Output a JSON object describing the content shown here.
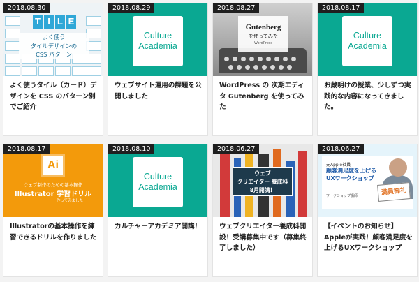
{
  "cards": [
    {
      "date": "2018.08.30",
      "title": "よく使うタイル（カード）デザインを CSS のパターン別でご紹介",
      "thumb_type": "tile",
      "thumb_text": {
        "word": [
          "T",
          "I",
          "L",
          "E"
        ],
        "line1": "よく使う",
        "line2": "タイルデザインの",
        "line3": "CSS パターン"
      }
    },
    {
      "date": "2018.08.29",
      "title": "ウェブサイト運用の課題を公開しました",
      "thumb_type": "culture",
      "thumb_text": {
        "line1": "Culture",
        "line2": "Academia"
      }
    },
    {
      "date": "2018.08.27",
      "title": "WordPress の 次期エディタ Gutenberg を使ってみた",
      "thumb_type": "gutenberg",
      "thumb_text": {
        "line1": "Gutenberg",
        "line2": "を使ってみた",
        "line3": "WordPress"
      }
    },
    {
      "date": "2018.08.17",
      "title": "お蔵明けの授業、少しずつ実践的な内容になってきました。",
      "thumb_type": "culture",
      "thumb_text": {
        "line1": "Culture",
        "line2": "Academia"
      }
    },
    {
      "date": "2018.08.17",
      "title": "Illustratorの基本操作を練習できるドリルを作りました",
      "thumb_type": "illustrator",
      "thumb_text": {
        "logo": "Ai",
        "line1": "ウェブ制作のための基本操作",
        "line2": "Illustrator 学習ドリル",
        "line3": "作ってみました"
      }
    },
    {
      "date": "2018.08.10",
      "title": "カルチャーアカデミア開講！",
      "thumb_type": "culture",
      "thumb_text": {
        "line1": "Culture",
        "line2": "Academia"
      }
    },
    {
      "date": "2018.06.27",
      "title": "ウェブクリエイター養成科開設！受講募集中です（募集終了しました）",
      "thumb_type": "webcreator",
      "thumb_text": {
        "line1": "ウェブ",
        "line2": "クリエイター 養成科",
        "line3": "8月開講！"
      }
    },
    {
      "date": "2018.06.27",
      "title": "【イベントのお知らせ】Appleが実践！顧客満足度を上げるUXワークショップ",
      "thumb_type": "ux",
      "thumb_text": {
        "line1": "元Apple社員",
        "line2": "顧客満足度を上げる",
        "line3": "UXワークショップ",
        "line4": "ワークショップ講師",
        "sign": "満員御礼"
      }
    }
  ],
  "colors": {
    "teal": "#0aa892",
    "date_bg": "#1f1f1f",
    "orange": "#f39a0b"
  }
}
